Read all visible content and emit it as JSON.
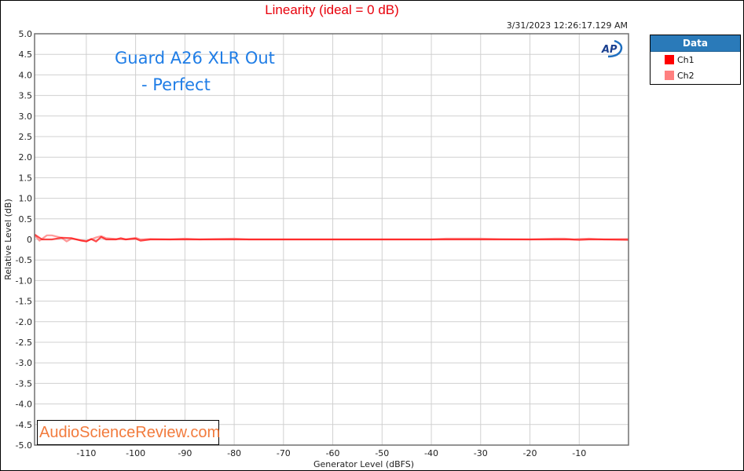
{
  "header": {
    "timestamp": "3/31/2023 12:26:17.129 AM"
  },
  "legend": {
    "title": "Data",
    "items": [
      {
        "label": "Ch1",
        "color": "#ff0000"
      },
      {
        "label": "Ch2",
        "color": "#ff8080"
      }
    ]
  },
  "annotations": {
    "line1": "Guard A26 XLR Out",
    "line2": "- Perfect",
    "watermark": "AudioScienceReview.com",
    "logo": "AP"
  },
  "chart_data": {
    "type": "line",
    "title": "Linearity (ideal = 0 dB)",
    "xlabel": "Generator Level (dBFS)",
    "ylabel": "Relative Level (dB)",
    "xlim": [
      -120.5,
      0
    ],
    "ylim": [
      -5.0,
      5.0
    ],
    "grid": true,
    "legend_position": "right-outside",
    "x_ticks": [
      -110,
      -100,
      -90,
      -80,
      -70,
      -60,
      -50,
      -40,
      -30,
      -20,
      -10
    ],
    "x_tick_labels": [
      "-110",
      "-100",
      "-90",
      "-80",
      "-70",
      "-60",
      "-50",
      "-40",
      "-30",
      "-20",
      "-10"
    ],
    "y_ticks": [
      5.0,
      4.5,
      4.0,
      3.5,
      3.0,
      2.5,
      2.0,
      1.5,
      1.0,
      0.5,
      0,
      -0.5,
      -1.0,
      -1.5,
      -2.0,
      -2.5,
      -3.0,
      -3.5,
      -4.0,
      -4.5,
      -5.0
    ],
    "y_tick_labels": [
      "5.0",
      "4.5",
      "4.0",
      "3.5",
      "3.0",
      "2.5",
      "2.0",
      "1.5",
      "1.0",
      "0.5",
      "0",
      "-0.5",
      "-1.0",
      "-1.5",
      "-2.0",
      "-2.5",
      "-3.0",
      "-3.5",
      "-4.0",
      "-4.5",
      "-5.0"
    ],
    "series": [
      {
        "name": "Ch1",
        "color": "#ff0000",
        "x": [
          -120.5,
          -119,
          -117,
          -115,
          -113,
          -111,
          -110,
          -109,
          -108,
          -107,
          -106,
          -104,
          -103,
          -102,
          -100,
          -99,
          -97,
          -95,
          -90,
          -85,
          -80,
          -75,
          -70,
          -60,
          -50,
          -40,
          -37,
          -30,
          -20,
          -15,
          -12,
          -10,
          -8,
          -5,
          0
        ],
        "y": [
          0.12,
          0.0,
          0.0,
          0.04,
          0.03,
          -0.03,
          -0.05,
          0.01,
          -0.05,
          0.06,
          0.0,
          0.0,
          0.03,
          0.0,
          0.02,
          -0.03,
          0.0,
          0.0,
          0.0,
          0.0,
          0.0,
          0.0,
          0.0,
          0.0,
          0.0,
          0.0,
          0.0,
          0.0,
          0.0,
          0.0,
          0.0,
          -0.01,
          0.0,
          0.0,
          -0.01
        ]
      },
      {
        "name": "Ch2",
        "color": "#ff8080",
        "x": [
          -120.5,
          -119.5,
          -118,
          -117,
          -115,
          -114,
          -113,
          -112,
          -110,
          -108,
          -107,
          -106,
          -104,
          -102,
          -100,
          -99,
          -97,
          -93,
          -90,
          -87,
          -84,
          -80,
          -77,
          -74,
          -70,
          -60,
          -50,
          -40,
          -37,
          -30,
          -27,
          -20,
          -15,
          -13,
          -11,
          -10,
          -8,
          -5,
          0
        ],
        "y": [
          0.1,
          -0.03,
          0.1,
          0.1,
          0.04,
          -0.05,
          0.02,
          0.0,
          -0.04,
          0.05,
          0.08,
          0.03,
          0.01,
          0.0,
          0.04,
          0.0,
          0.01,
          0.0,
          0.02,
          0.0,
          0.01,
          0.02,
          0.0,
          0.0,
          0.0,
          0.0,
          0.0,
          0.0,
          0.02,
          0.02,
          0.01,
          0.0,
          0.02,
          0.02,
          0.0,
          0.01,
          0.02,
          0.0,
          0.01
        ]
      }
    ]
  }
}
